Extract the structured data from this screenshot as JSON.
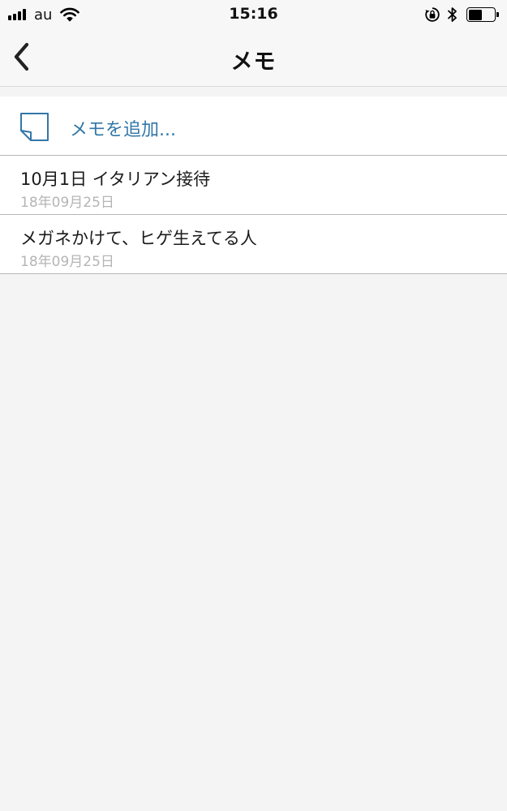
{
  "status_bar": {
    "carrier": "au",
    "time": "15:16",
    "signal_bars": 4,
    "battery_level": 0.55,
    "icons": [
      "signal-bars-icon",
      "wifi-icon",
      "orientation-lock-icon",
      "bluetooth-icon",
      "battery-icon"
    ]
  },
  "nav": {
    "back_icon": "chevron-left-icon",
    "title": "メモ"
  },
  "memos": {
    "add_icon": "note-icon",
    "add_label": "メモを追加...",
    "items": [
      {
        "title": "10月1日 イタリアン接待",
        "date": "18年09月25日"
      },
      {
        "title": "メガネかけて、ヒゲ生えてる人",
        "date": "18年09月25日"
      }
    ]
  },
  "colors": {
    "accent": "#3277a8",
    "background": "#f4f4f4",
    "bar_background": "#f7f7f7",
    "divider": "#b7b7b7",
    "date_text": "#b5b5b5"
  }
}
